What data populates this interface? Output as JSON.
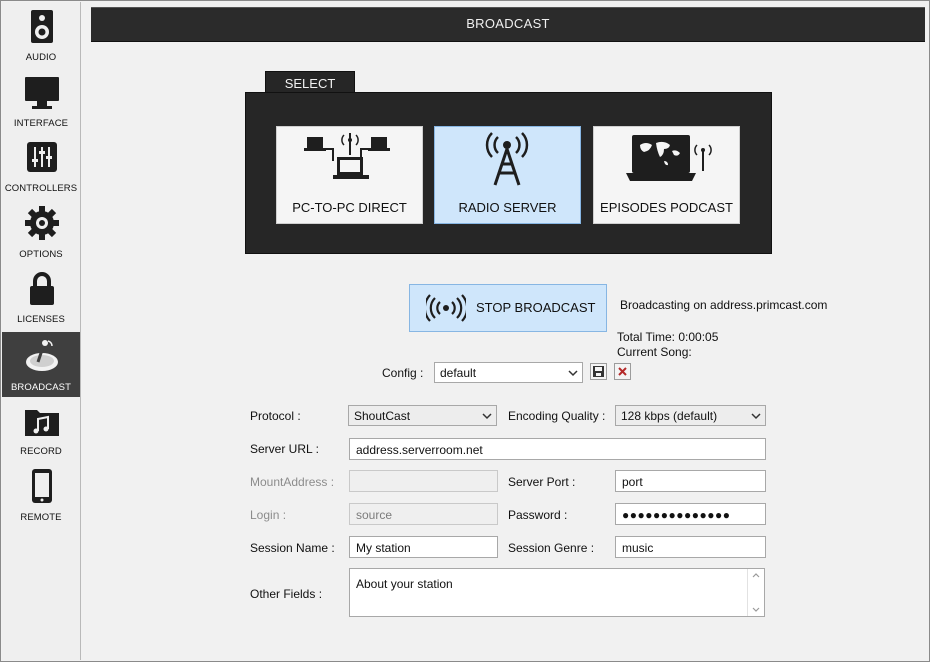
{
  "sidebar": {
    "items": [
      {
        "label": "AUDIO",
        "icon": "speaker-icon"
      },
      {
        "label": "INTERFACE",
        "icon": "monitor-icon"
      },
      {
        "label": "CONTROLLERS",
        "icon": "sliders-icon"
      },
      {
        "label": "OPTIONS",
        "icon": "gear-icon"
      },
      {
        "label": "LICENSES",
        "icon": "lock-icon"
      },
      {
        "label": "BROADCAST",
        "icon": "broadcast-dish-icon",
        "active": true
      },
      {
        "label": "RECORD",
        "icon": "music-folder-icon"
      },
      {
        "label": "REMOTE",
        "icon": "phone-icon"
      }
    ]
  },
  "header": {
    "title": "BROADCAST"
  },
  "select": {
    "tab_label": "SELECT",
    "options": [
      {
        "label": "PC-TO-PC DIRECT",
        "icon": "network-computers-icon"
      },
      {
        "label": "RADIO SERVER",
        "icon": "radio-tower-icon",
        "active": true
      },
      {
        "label": "EPISODES PODCAST",
        "icon": "laptop-world-icon"
      }
    ]
  },
  "broadcast": {
    "stop_label": "STOP BROADCAST",
    "status": "Broadcasting on address.primcast.com",
    "total_time": "Total Time: 0:00:05",
    "current_song": "Current Song:"
  },
  "config": {
    "label": "Config :",
    "value": "default"
  },
  "form": {
    "protocol_label": "Protocol :",
    "protocol_value": "ShoutCast",
    "encoding_label": "Encoding Quality :",
    "encoding_value": "128 kbps (default)",
    "server_url_label": "Server URL :",
    "server_url_value": "address.serverroom.net",
    "mount_label": "MountAddress :",
    "mount_value": "",
    "server_port_label": "Server Port :",
    "server_port_value": "port",
    "login_label": "Login :",
    "login_value": "source",
    "password_label": "Password :",
    "password_value": "●●●●●●●●●●●●●●",
    "session_name_label": "Session Name :",
    "session_name_value": "My station",
    "session_genre_label": "Session Genre :",
    "session_genre_value": "music",
    "other_fields_label": "Other Fields :",
    "other_fields_value": "About your station"
  },
  "colors": {
    "accent": "#cfe6fb",
    "accent_border": "#87b6e3",
    "dark_panel": "#262626",
    "sidebar_active": "#3f3f3f"
  }
}
